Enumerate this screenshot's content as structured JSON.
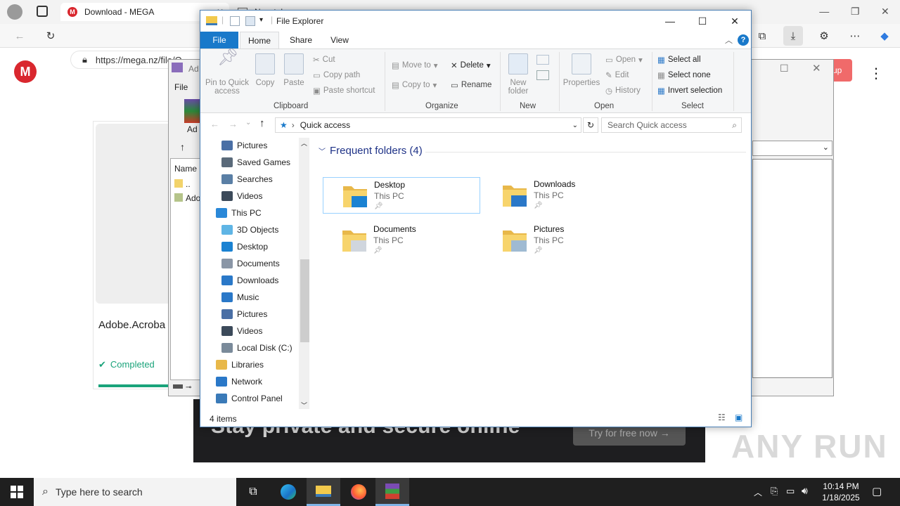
{
  "browser": {
    "tabs": [
      {
        "title": "Download - MEGA"
      },
      {
        "title": "New tab"
      }
    ],
    "url": "https://mega.nz/file/Q"
  },
  "mega_page": {
    "logo": "M",
    "filename": "Adobe.Acroba",
    "status": "Completed",
    "progress_fraction": 1.0,
    "signup_label": "up",
    "promo_text": "Stay private and secure online",
    "promo_button": "Try for free now →",
    "watermark": "ANY RUN"
  },
  "winrar_bg": {
    "title": "Ad",
    "menu_file": "File",
    "column_name": "Name",
    "row_up": "..",
    "row_file": "Ado",
    "toolbar_label": "Ad"
  },
  "explorer": {
    "title": "File Explorer",
    "ribbon_tabs": [
      "File",
      "Home",
      "Share",
      "View"
    ],
    "clipboard": {
      "pin": "Pin to Quick access",
      "copy": "Copy",
      "paste": "Paste",
      "cut": "Cut",
      "copy_path": "Copy path",
      "paste_shortcut": "Paste shortcut",
      "group": "Clipboard"
    },
    "organize": {
      "move_to": "Move to",
      "copy_to": "Copy to",
      "delete": "Delete",
      "rename": "Rename",
      "group": "Organize"
    },
    "new": {
      "new_folder": "New folder",
      "group": "New"
    },
    "open": {
      "properties": "Properties",
      "open": "Open",
      "edit": "Edit",
      "history": "History",
      "group": "Open"
    },
    "select": {
      "select_all": "Select all",
      "select_none": "Select none",
      "invert": "Invert selection",
      "group": "Select"
    },
    "address": "Quick access",
    "search_placeholder": "Search Quick access",
    "nav_items": [
      {
        "label": "Pictures",
        "icon": "pictures-icon",
        "color": "#4a6fa5"
      },
      {
        "label": "Saved Games",
        "icon": "saved-games-icon",
        "color": "#5a6a7a"
      },
      {
        "label": "Searches",
        "icon": "search-icon",
        "color": "#5a7fa5"
      },
      {
        "label": "Videos",
        "icon": "videos-icon",
        "color": "#3c4a5a"
      },
      {
        "label": "This PC",
        "icon": "this-pc-icon",
        "color": "#2a88d8",
        "level": 1
      },
      {
        "label": "3D Objects",
        "icon": "3d-objects-icon",
        "color": "#5fb5e5"
      },
      {
        "label": "Desktop",
        "icon": "desktop-icon",
        "color": "#1a82d2"
      },
      {
        "label": "Documents",
        "icon": "documents-icon",
        "color": "#8a96a6"
      },
      {
        "label": "Downloads",
        "icon": "downloads-icon",
        "color": "#2a78c8"
      },
      {
        "label": "Music",
        "icon": "music-icon",
        "color": "#2a78c8"
      },
      {
        "label": "Pictures",
        "icon": "pictures-icon",
        "color": "#4a6fa5"
      },
      {
        "label": "Videos",
        "icon": "videos-icon",
        "color": "#3c4a5a"
      },
      {
        "label": "Local Disk (C:)",
        "icon": "drive-icon",
        "color": "#7a8a9a"
      },
      {
        "label": "Libraries",
        "icon": "libraries-icon",
        "color": "#e8b84a",
        "level": 1
      },
      {
        "label": "Network",
        "icon": "network-icon",
        "color": "#2a78c8",
        "level": 1
      },
      {
        "label": "Control Panel",
        "icon": "control-panel-icon",
        "color": "#3a7ab8",
        "level": 1
      }
    ],
    "section_title": "Frequent folders (4)",
    "folders": [
      {
        "name": "Desktop",
        "location": "This PC",
        "overlay": "#1a82d2",
        "selected": true
      },
      {
        "name": "Downloads",
        "location": "This PC",
        "overlay": "#2a78c8",
        "selected": false
      },
      {
        "name": "Documents",
        "location": "This PC",
        "overlay": "#d0d6de",
        "selected": false
      },
      {
        "name": "Pictures",
        "location": "This PC",
        "overlay": "#9fbad2",
        "selected": false
      }
    ],
    "status": "4 items"
  },
  "taskbar": {
    "search_placeholder": "Type here to search",
    "time": "10:14 PM",
    "date": "1/18/2025"
  },
  "colors": {
    "accent": "#1979ca",
    "mega_red": "#d9272e",
    "success": "#1aa37a"
  }
}
